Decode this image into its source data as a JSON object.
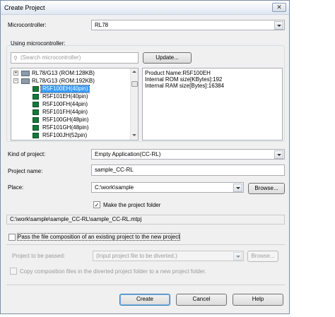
{
  "window": {
    "title": "Create Project",
    "close_glyph": "✕"
  },
  "microcontroller": {
    "label": "Microcontroller:",
    "value": "RL78"
  },
  "using_microcontroller": {
    "label": "Using microcontroller:",
    "search_placeholder": "(Search microcontroller)",
    "update_label": "Update...",
    "tree": [
      {
        "label": "RL78/G13 (ROM:128KB)",
        "expanded": false,
        "kind": "group"
      },
      {
        "label": "RL78/G13 (ROM:192KB)",
        "expanded": true,
        "kind": "group"
      },
      {
        "label": "R5F100EH(40pin)",
        "selected": true,
        "kind": "device"
      },
      {
        "label": "R5F101EH(40pin)",
        "kind": "device"
      },
      {
        "label": "R5F100FH(44pin)",
        "kind": "device"
      },
      {
        "label": "R5F101FH(44pin)",
        "kind": "device"
      },
      {
        "label": "R5F100GH(48pin)",
        "kind": "device"
      },
      {
        "label": "R5F101GH(48pin)",
        "kind": "device"
      },
      {
        "label": "R5F100JH(52pin)",
        "kind": "device"
      }
    ],
    "info_lines": [
      "Product Name:R5F100EH",
      "Internal ROM size[KBytes]:192",
      "Internal RAM size[Bytes]:16384"
    ]
  },
  "kind_of_project": {
    "label": "Kind of project:",
    "value": "Empty Application(CC-RL)"
  },
  "project_name": {
    "label": "Project name:",
    "value": "sample_CC-RL"
  },
  "place": {
    "label": "Place:",
    "value": "C:\\work\\sample",
    "browse_label": "Browse..."
  },
  "make_folder": {
    "label": "Make the project folder",
    "checked": true,
    "check_glyph": "✓"
  },
  "project_path": "C:\\work\\sample\\sample_CC-RL\\sample_CC-RL.mtpj",
  "pass_composition": {
    "label": "Pass the file composition of an existing project to the new project",
    "checked": false
  },
  "project_to_pass": {
    "label": "Project to be passed:",
    "placeholder": "(Input project file to be diverted.)",
    "browse_label": "Browse..."
  },
  "copy_files": {
    "label": "Copy composition files in the diverted project folder to a new project folder.",
    "checked": false
  },
  "buttons": {
    "create": "Create",
    "cancel": "Cancel",
    "help": "Help"
  },
  "tree_glyphs": {
    "collapsed": "+",
    "expanded": "−"
  }
}
